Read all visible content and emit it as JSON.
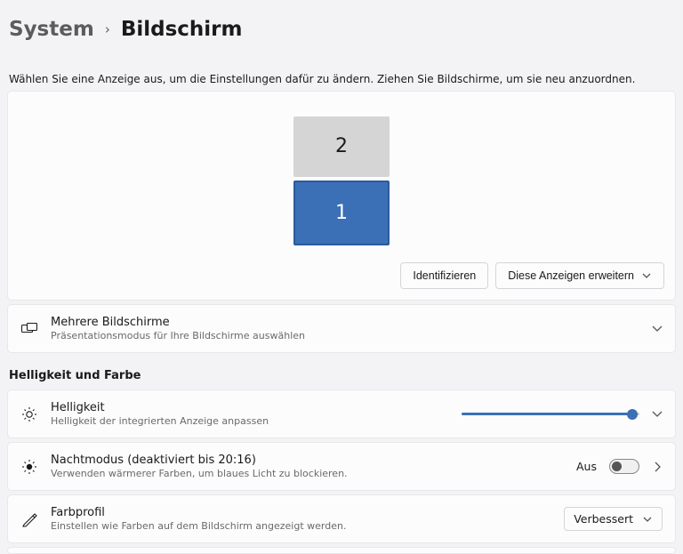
{
  "breadcrumb": {
    "parent": "System",
    "current": "Bildschirm"
  },
  "helper": "Wählen Sie eine Anzeige aus, um die Einstellungen dafür zu ändern. Ziehen Sie Bildschirme, um sie neu anzuordnen.",
  "monitors": {
    "primary": "1",
    "secondary": "2"
  },
  "arrange_buttons": {
    "identify": "Identifizieren",
    "extend": "Diese Anzeigen erweitern"
  },
  "multi_disp": {
    "title": "Mehrere Bildschirme",
    "sub": "Präsentationsmodus für Ihre Bildschirme auswählen"
  },
  "section_brightness_color": "Helligkeit und Farbe",
  "brightness": {
    "title": "Helligkeit",
    "sub": "Helligkeit der integrierten Anzeige anpassen"
  },
  "nightlight": {
    "title": "Nachtmodus (deaktiviert bis 20:16)",
    "sub": "Verwenden wärmerer Farben, um blaues Licht zu blockieren.",
    "state": "Aus"
  },
  "colorprofile": {
    "title": "Farbprofil",
    "sub": "Einstellen wie Farben auf dem Bildschirm angezeigt werden.",
    "value": "Verbessert"
  }
}
